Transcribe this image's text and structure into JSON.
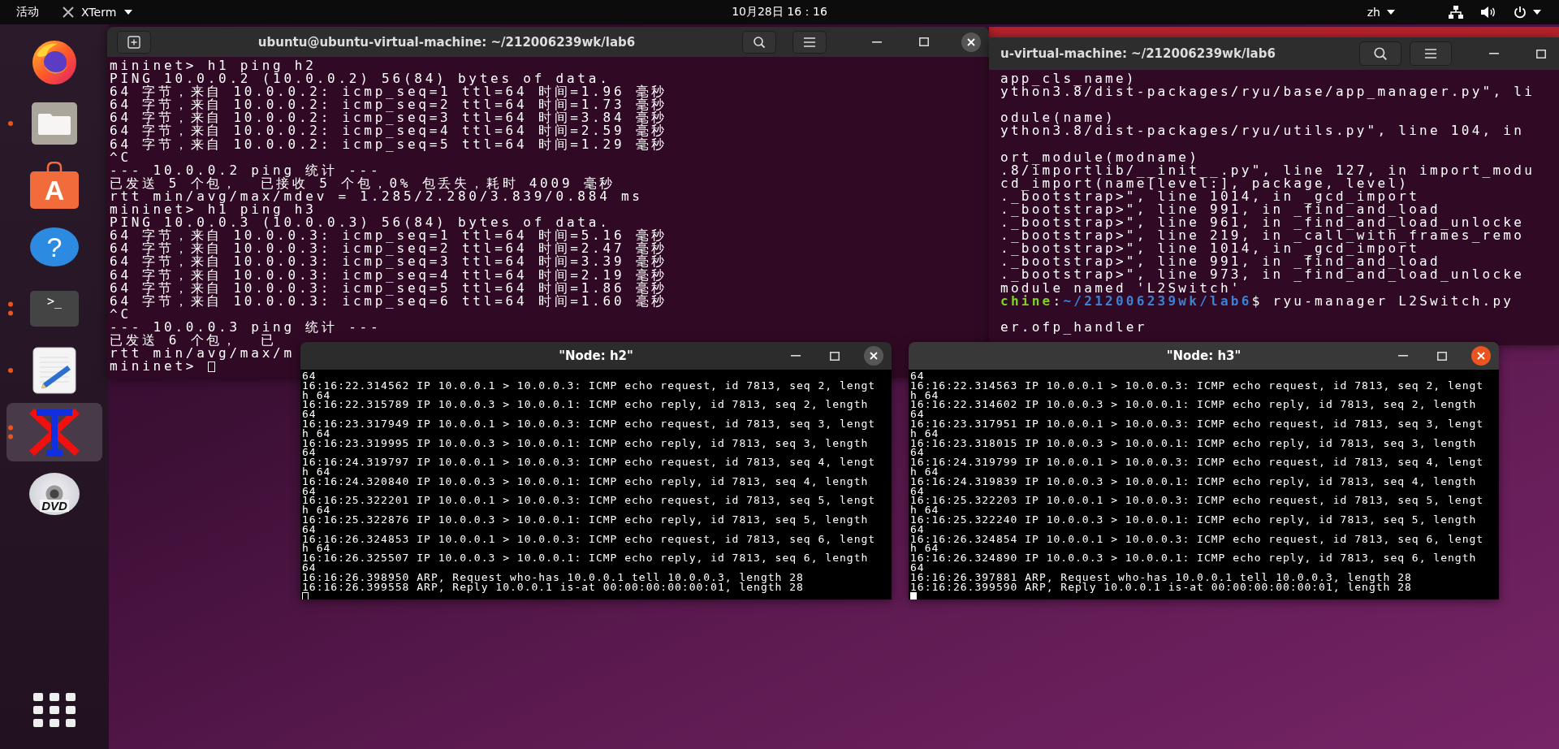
{
  "top_bar": {
    "activities": "活动",
    "app_menu": "XTerm",
    "clock": "10月28日  16：16",
    "input_method": "zh"
  },
  "dock": {
    "items": [
      {
        "kind": "browser",
        "running": false,
        "several_windows": false,
        "selected": false
      },
      {
        "kind": "files",
        "running": true,
        "several_windows": false,
        "selected": false
      },
      {
        "kind": "software",
        "glyph": "A",
        "running": false,
        "several_windows": false,
        "selected": false
      },
      {
        "kind": "help",
        "glyph": "?",
        "running": false,
        "several_windows": false,
        "selected": false
      },
      {
        "kind": "terminal",
        "glyph": ">_",
        "running": true,
        "several_windows": true,
        "selected": false
      },
      {
        "kind": "editor",
        "running": true,
        "several_windows": false,
        "selected": false
      },
      {
        "kind": "xterm",
        "running": true,
        "several_windows": true,
        "selected": true
      },
      {
        "kind": "disc",
        "glyph": "DVD",
        "running": false,
        "several_windows": false,
        "selected": false
      }
    ]
  },
  "windows": [
    {
      "kind": "terminal",
      "title": "ubuntu@ubuntu-virtual-machine: ~/212006239wk/lab6",
      "focused": false,
      "cursor": true,
      "blocks": [
        [
          "mininet> h1 ping h2",
          "PING 10.0.0.2 (10.0.0.2) 56(84) bytes of data.",
          "64 字节，来自 10.0.0.2: icmp_seq=1 ttl=64 时间=1.96 毫秒",
          "64 字节，来自 10.0.0.2: icmp_seq=2 ttl=64 时间=1.73 毫秒",
          "64 字节，来自 10.0.0.2: icmp_seq=3 ttl=64 时间=3.84 毫秒",
          "64 字节，来自 10.0.0.2: icmp_seq=4 ttl=64 时间=2.59 毫秒",
          "64 字节，来自 10.0.0.2: icmp_seq=5 ttl=64 时间=1.29 毫秒",
          "^C",
          "--- 10.0.0.2 ping 统计 ---",
          "已发送 5 个包，  已接收 5 个包，0% 包丢失，耗时 4009 毫秒",
          "rtt min/avg/max/mdev = 1.285/2.280/3.839/0.884 ms",
          "mininet> h1 ping h3",
          "PING 10.0.0.3 (10.0.0.3) 56(84) bytes of data.",
          "64 字节，来自 10.0.0.3: icmp_seq=1 ttl=64 时间=5.16 毫秒",
          "64 字节，来自 10.0.0.3: icmp_seq=2 ttl=64 时间=2.47 毫秒",
          "64 字节，来自 10.0.0.3: icmp_seq=3 ttl=64 时间=3.39 毫秒",
          "64 字节，来自 10.0.0.3: icmp_seq=4 ttl=64 时间=2.19 毫秒",
          "64 字节，来自 10.0.0.3: icmp_seq=5 ttl=64 时间=1.86 毫秒",
          "64 字节，来自 10.0.0.3: icmp_seq=6 ttl=64 时间=1.60 毫秒",
          "^C",
          "--- 10.0.0.3 ping 统计 ---",
          "已发送 6 个包，  已",
          "rtt min/avg/max/m",
          "mininet> "
        ]
      ]
    },
    {
      "kind": "terminal-behind",
      "title": "u-virtual-machine: ~/212006239wk/lab6",
      "blocks": [
        [
          "app_cls_name)",
          "ython3.8/dist-packages/ryu/base/app_manager.py\", li"
        ],
        [
          "odule(name)",
          "ython3.8/dist-packages/ryu/utils.py\", line 104, in"
        ],
        [
          "ort_module(modname)",
          ".8/importlib/__init__.py\", line 127, in import_modu",
          "cd_import(name[level:], package, level)",
          "._bootstrap>\", line 1014, in _gcd_import",
          "._bootstrap>\", line 991, in _find_and_load",
          "._bootstrap>\", line 961, in _find_and_load_unlocke",
          "._bootstrap>\", line 219, in _call_with_frames_remo",
          "._bootstrap>\", line 1014, in _gcd_import",
          "._bootstrap>\", line 991, in _find_and_load",
          "._bootstrap>\", line 973, in _find_and_load_unlocke",
          "module named 'L2Switch'",
          {
            "kind": "prompt",
            "host": "chine",
            "separator": ":",
            "path": "~/212006239wk/lab6",
            "command": "$ ryu-manager L2Switch.py"
          }
        ],
        [
          "er.ofp_handler"
        ]
      ]
    },
    {
      "kind": "xterm",
      "title": "\"Node: h2\"",
      "focused": false,
      "cursor": true,
      "blocks": [
        [
          "64",
          "16:16:22.314562 IP 10.0.0.1 > 10.0.0.3: ICMP echo request, id 7813, seq 2, lengt",
          "h 64",
          "16:16:22.315789 IP 10.0.0.3 > 10.0.0.1: ICMP echo reply, id 7813, seq 2, length",
          "64",
          "16:16:23.317949 IP 10.0.0.1 > 10.0.0.3: ICMP echo request, id 7813, seq 3, lengt",
          "h 64",
          "16:16:23.319995 IP 10.0.0.3 > 10.0.0.1: ICMP echo reply, id 7813, seq 3, length",
          "64",
          "16:16:24.319797 IP 10.0.0.1 > 10.0.0.3: ICMP echo request, id 7813, seq 4, lengt",
          "h 64",
          "16:16:24.320840 IP 10.0.0.3 > 10.0.0.1: ICMP echo reply, id 7813, seq 4, length",
          "64",
          "16:16:25.322201 IP 10.0.0.1 > 10.0.0.3: ICMP echo request, id 7813, seq 5, lengt",
          "h 64",
          "16:16:25.322876 IP 10.0.0.3 > 10.0.0.1: ICMP echo reply, id 7813, seq 5, length",
          "64",
          "16:16:26.324853 IP 10.0.0.1 > 10.0.0.3: ICMP echo request, id 7813, seq 6, lengt",
          "h 64",
          "16:16:26.325507 IP 10.0.0.3 > 10.0.0.1: ICMP echo reply, id 7813, seq 6, length",
          "64",
          "16:16:26.398950 ARP, Request who-has 10.0.0.1 tell 10.0.0.3, length 28",
          "16:16:26.399558 ARP, Reply 10.0.0.1 is-at 00:00:00:00:00:01, length 28"
        ]
      ]
    },
    {
      "kind": "xterm",
      "title": "\"Node: h3\"",
      "focused": true,
      "cursor": true,
      "blocks": [
        [
          "64",
          "16:16:22.314563 IP 10.0.0.1 > 10.0.0.3: ICMP echo request, id 7813, seq 2, lengt",
          "h 64",
          "16:16:22.314602 IP 10.0.0.3 > 10.0.0.1: ICMP echo reply, id 7813, seq 2, length",
          "64",
          "16:16:23.317951 IP 10.0.0.1 > 10.0.0.3: ICMP echo request, id 7813, seq 3, lengt",
          "h 64",
          "16:16:23.318015 IP 10.0.0.3 > 10.0.0.1: ICMP echo reply, id 7813, seq 3, length",
          "64",
          "16:16:24.319799 IP 10.0.0.1 > 10.0.0.3: ICMP echo request, id 7813, seq 4, lengt",
          "h 64",
          "16:16:24.319839 IP 10.0.0.3 > 10.0.0.1: ICMP echo reply, id 7813, seq 4, length",
          "64",
          "16:16:25.322203 IP 10.0.0.1 > 10.0.0.3: ICMP echo request, id 7813, seq 5, lengt",
          "h 64",
          "16:16:25.322240 IP 10.0.0.3 > 10.0.0.1: ICMP echo reply, id 7813, seq 5, length",
          "64",
          "16:16:26.324854 IP 10.0.0.1 > 10.0.0.3: ICMP echo request, id 7813, seq 6, lengt",
          "h 64",
          "16:16:26.324890 IP 10.0.0.3 > 10.0.0.1: ICMP echo reply, id 7813, seq 6, length",
          "64",
          "16:16:26.397881 ARP, Request who-has 10.0.0.1 tell 10.0.0.3, length 28",
          "16:16:26.399590 ARP, Reply 10.0.0.1 is-at 00:00:00:00:00:01, length 28"
        ]
      ]
    }
  ]
}
